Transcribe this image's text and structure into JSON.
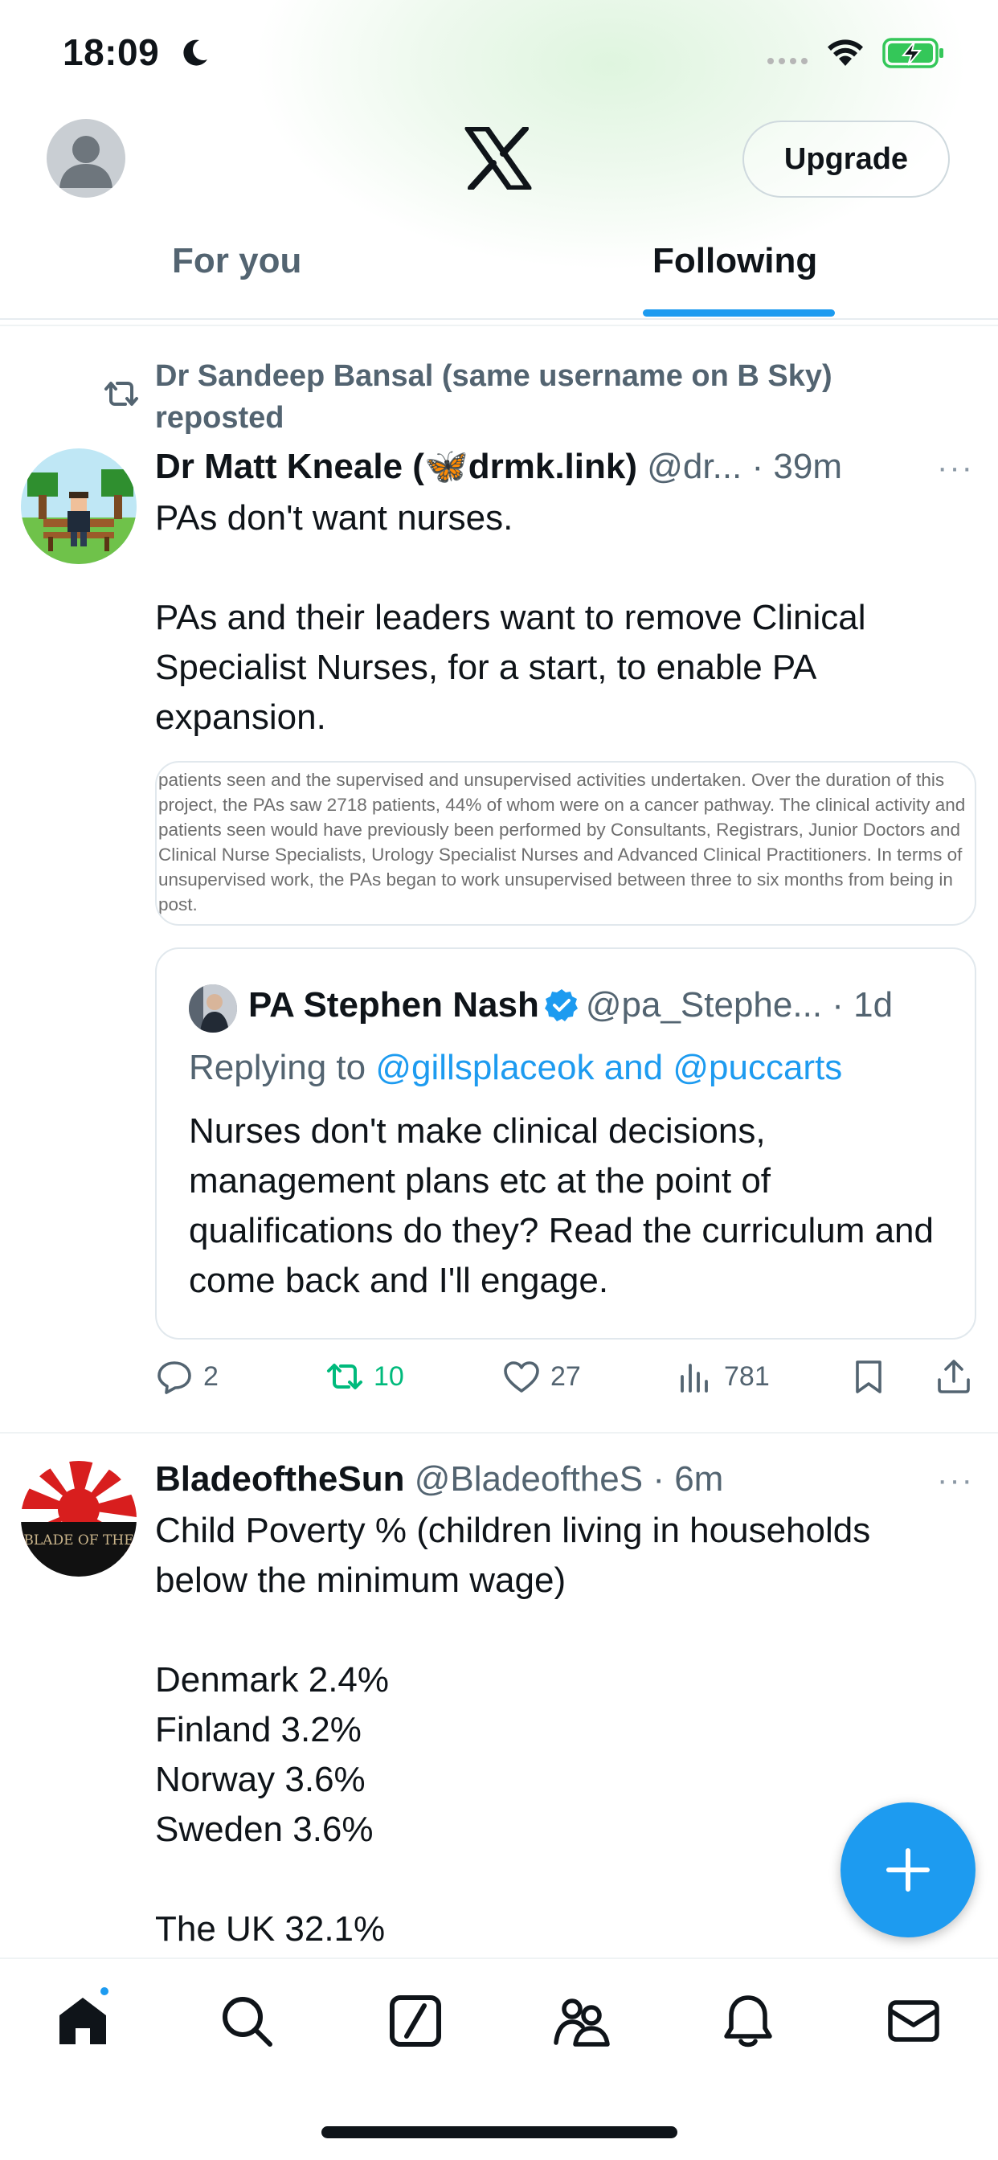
{
  "status_bar": {
    "time": "18:09"
  },
  "header": {
    "upgrade_label": "Upgrade"
  },
  "tabs": [
    {
      "label": "For you",
      "active": false
    },
    {
      "label": "Following",
      "active": true
    }
  ],
  "colors": {
    "accent": "#1d9bf0",
    "repost_green": "#00ba7c",
    "muted": "#536471"
  },
  "tweets": [
    {
      "repost_context": "Dr Sandeep Bansal (same username on B Sky) reposted",
      "author_name": "Dr Matt Kneale (🦋drmk.link)",
      "handle_time": "@dr... · 39m",
      "more": "···",
      "body": "PAs don't want nurses.\n\nPAs and their leaders want to remove Clinical Specialist Nurses, for a start, to enable PA expansion.",
      "media_text": "patients seen and the supervised and unsupervised activities undertaken. Over the duration of this project, the PAs saw 2718 patients, 44% of whom were on a cancer pathway. The clinical activity and patients seen would have previously been performed by Consultants, Registrars, Junior Doctors and Clinical Nurse Specialists, Urology Specialist Nurses and Advanced Clinical Practitioners. In terms of unsupervised work, the PAs began to work unsupervised between three to six months from being in post.",
      "quote": {
        "author_name": "PA Stephen Nash",
        "handle_time": "@pa_Stephe... · 1d",
        "replying_prefix": "Replying to ",
        "replying_mentions": "@gillsplaceok and @puccarts",
        "body": "Nurses don't make clinical decisions, management plans etc at the point of qualifications do they? Read the curriculum and come back and I'll engage."
      },
      "stats": {
        "replies": "2",
        "reposts": "10",
        "likes": "27",
        "views": "781"
      }
    },
    {
      "author_name": "BladeoftheSun",
      "handle_time": "@BladeoftheS · 6m",
      "more": "···",
      "avatar_text": "BLADE OF THE",
      "body": "Child Poverty % (children living in households below the minimum wage)\n\nDenmark 2.4%\nFinland 3.2%\nNorway 3.6%\nSweden 3.6%\n\nThe UK 32.1%"
    }
  ],
  "nav_icons": [
    "home-icon",
    "search-icon",
    "grok-icon",
    "communities-icon",
    "notifications-icon",
    "messages-icon"
  ]
}
